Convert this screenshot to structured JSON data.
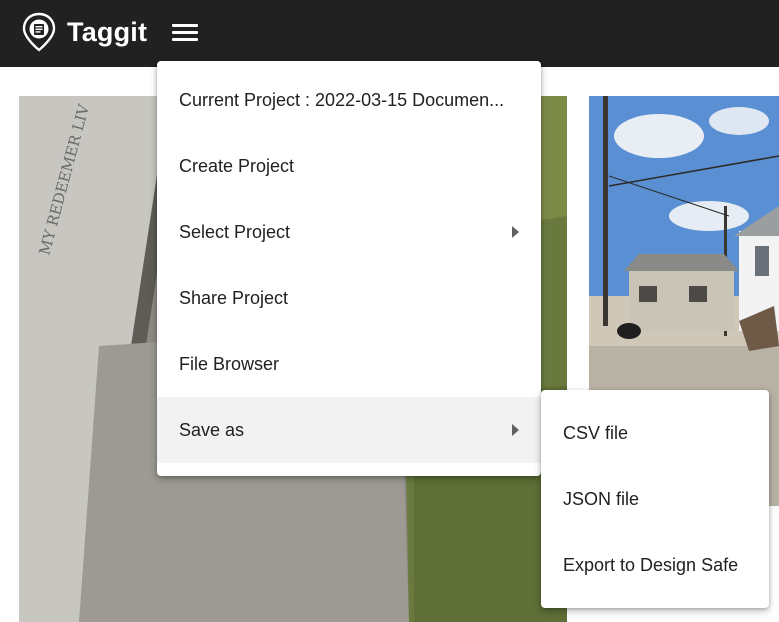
{
  "app": {
    "title": "Taggit",
    "logo_icon": "map-pin-document-icon",
    "menu_icon": "hamburger-menu-icon"
  },
  "colors": {
    "topbar": "#212121",
    "menu_bg": "#ffffff",
    "active_item_bg": "#f2f2f2",
    "text": "#212121"
  },
  "menu": {
    "items": [
      {
        "label": "Current Project : 2022-03-15 Documen...",
        "has_submenu": false
      },
      {
        "label": "Create Project",
        "has_submenu": false
      },
      {
        "label": "Select Project",
        "has_submenu": true
      },
      {
        "label": "Share Project",
        "has_submenu": false
      },
      {
        "label": "File Browser",
        "has_submenu": false
      },
      {
        "label": "Save as",
        "has_submenu": true,
        "active": true
      }
    ]
  },
  "submenu": {
    "items": [
      {
        "label": "CSV file"
      },
      {
        "label": "JSON file"
      },
      {
        "label": "Export to Design Safe"
      }
    ]
  },
  "gallery": {
    "images": [
      {
        "subject": "gravestone"
      },
      {
        "subject": "damaged houses street"
      }
    ]
  }
}
